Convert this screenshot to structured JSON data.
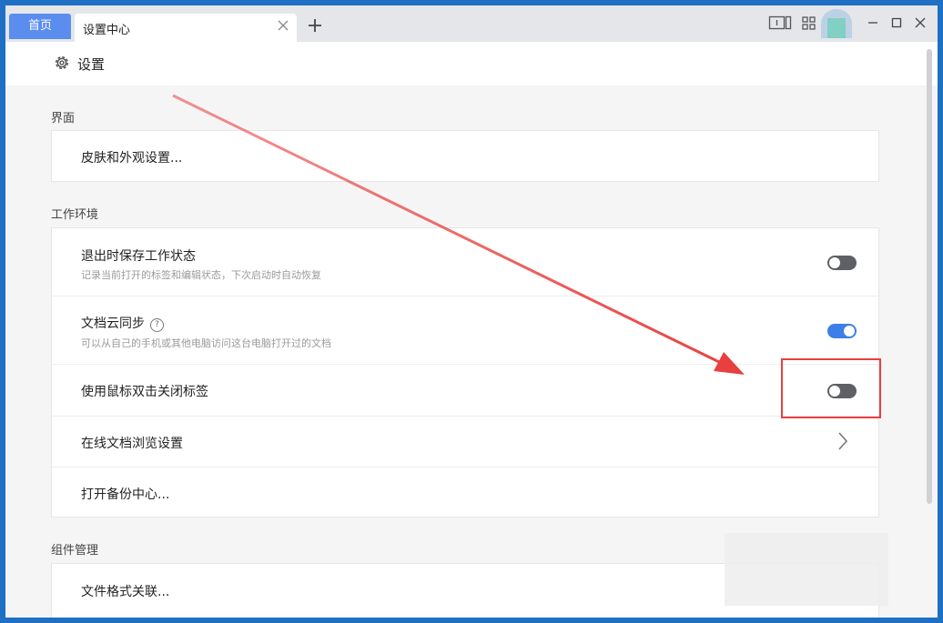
{
  "tabs": {
    "home_label": "首页",
    "active_label": "设置中心"
  },
  "header": {
    "title": "设置"
  },
  "sections": {
    "interface": {
      "title": "界面",
      "items": [
        {
          "title": "皮肤和外观设置..."
        }
      ]
    },
    "workspace": {
      "title": "工作环境",
      "items": [
        {
          "title": "退出时保存工作状态",
          "desc": "记录当前打开的标签和编辑状态，下次启动时自动恢复",
          "toggle": "off"
        },
        {
          "title": "文档云同步",
          "help_glyph": "?",
          "desc": "可以从自己的手机或其他电脑访问这台电脑打开过的文档",
          "toggle": "on"
        },
        {
          "title": "使用鼠标双击关闭标签",
          "toggle": "off"
        },
        {
          "title": "在线文档浏览设置"
        },
        {
          "title": "打开备份中心..."
        }
      ]
    },
    "components": {
      "title": "组件管理",
      "items": [
        {
          "title": "文件格式关联..."
        }
      ]
    }
  },
  "icons": {
    "toolbar": [
      "reading-mode-icon",
      "grid-apps-icon"
    ],
    "window": [
      "minimize-icon",
      "maximize-icon",
      "close-icon"
    ]
  },
  "colors": {
    "accent": "#3d7ee8",
    "home_tab": "#5b8def",
    "annotation": "#e8403e"
  }
}
